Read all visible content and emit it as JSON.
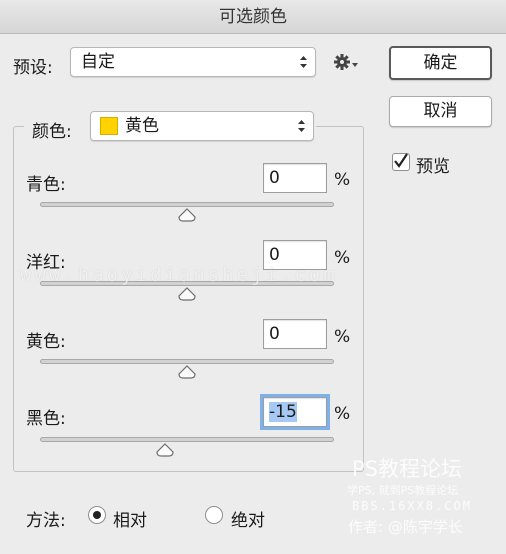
{
  "window": {
    "title": "可选颜色"
  },
  "preset": {
    "label": "预设:",
    "value": "自定"
  },
  "buttons": {
    "ok": "确定",
    "cancel": "取消"
  },
  "preview": {
    "label": "预览",
    "checked": true
  },
  "colors": {
    "label": "颜色:",
    "value": "黄色",
    "swatch": "#ffd200"
  },
  "sliders": [
    {
      "label": "青色:",
      "value": "0",
      "unit": "%",
      "percent": 0
    },
    {
      "label": "洋红:",
      "value": "0",
      "unit": "%",
      "percent": 0
    },
    {
      "label": "黄色:",
      "value": "0",
      "unit": "%",
      "percent": 0
    },
    {
      "label": "黑色:",
      "value": "-15",
      "unit": "%",
      "percent": -15
    }
  ],
  "method": {
    "label": "方法:",
    "relative": "相对",
    "absolute": "绝对",
    "selected": "relative"
  },
  "watermark": {
    "site": "www.haoyidiansheji.com",
    "forum_title": "PS教程论坛",
    "forum_sub": "学PS, 就到PS教程论坛",
    "forum_url": "BBS.16XX8.COM",
    "author": "作者: @陈宇学长"
  }
}
